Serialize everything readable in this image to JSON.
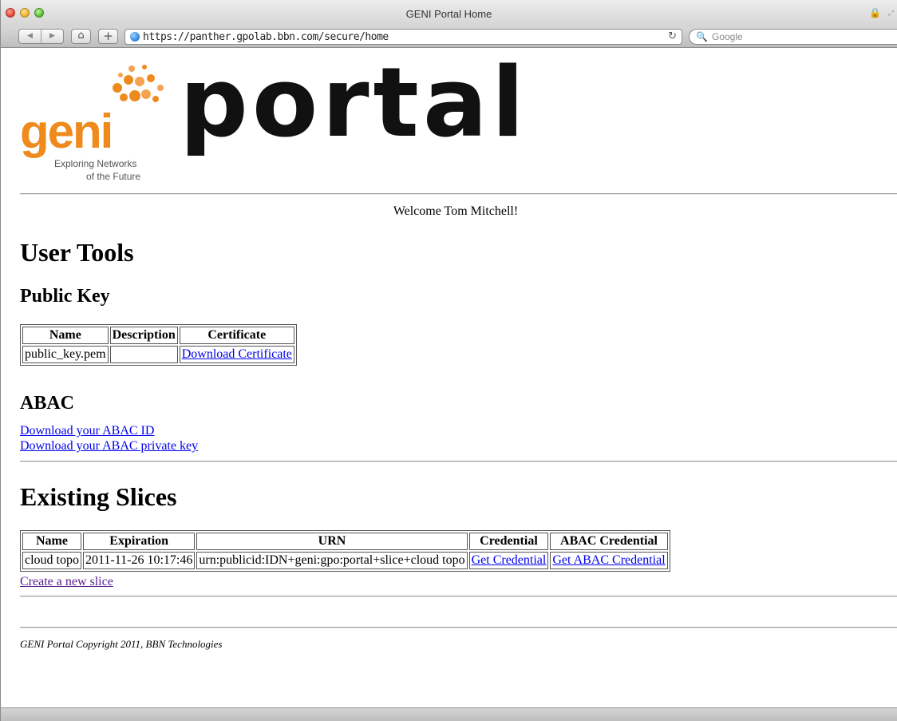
{
  "window": {
    "title": "GENI Portal Home"
  },
  "toolbar": {
    "back_icon": "◀",
    "forward_icon": "▶",
    "home_icon": "⌂",
    "plus_label": "+",
    "url": "https://panther.gpolab.bbn.com/secure/home",
    "reload_icon": "↻",
    "search_icon": "🔍",
    "search_placeholder": "Google"
  },
  "logo": {
    "geni": "geni",
    "tagline_1": "Exploring Networks",
    "tagline_2": "of the Future",
    "portal": "portal"
  },
  "welcome": "Welcome Tom Mitchell!",
  "user_tools": {
    "heading": "User Tools",
    "public_key": {
      "heading": "Public Key",
      "headers": [
        "Name",
        "Description",
        "Certificate"
      ],
      "row": {
        "name": "public_key.pem",
        "description": "",
        "certificate_link": "Download Certificate"
      }
    },
    "abac": {
      "heading": "ABAC",
      "link_id": "Download your ABAC ID",
      "link_key": "Download your ABAC private key"
    }
  },
  "slices": {
    "heading": "Existing Slices",
    "headers": [
      "Name",
      "Expiration",
      "URN",
      "Credential",
      "ABAC Credential"
    ],
    "rows": [
      {
        "name": "cloud topo",
        "expiration": "2011-11-26 10:17:46",
        "urn": "urn:publicid:IDN+geni:gpo:portal+slice+cloud topo",
        "credential": "Get Credential",
        "abac_credential": "Get ABAC Credential"
      }
    ],
    "create_link": "Create a new slice"
  },
  "footer": "GENI Portal Copyright 2011, BBN Technologies",
  "colors": {
    "geni_orange": "#ef8a1d",
    "link": "#0000ee",
    "visited_link": "#551a8b"
  }
}
